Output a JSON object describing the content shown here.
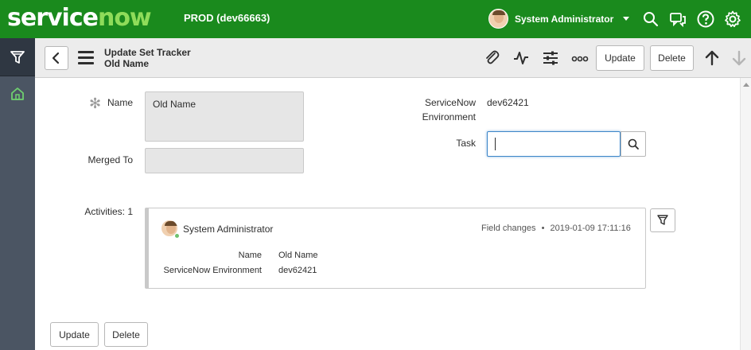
{
  "header": {
    "logo_part1": "service",
    "logo_part2": "now",
    "instance": "PROD (dev66663)",
    "user": "System Administrator"
  },
  "form_header": {
    "title": "Update Set Tracker",
    "subtitle": "Old Name",
    "update_label": "Update",
    "delete_label": "Delete"
  },
  "fields": {
    "name_label": "Name",
    "name_value": "Old Name",
    "merged_to_label": "Merged To",
    "merged_to_value": "",
    "sn_env_label_1": "ServiceNow",
    "sn_env_label_2": "Environment",
    "sn_env_value": "dev62421",
    "task_label": "Task",
    "task_value": ""
  },
  "activities": {
    "label": "Activities: 1",
    "entry": {
      "user": "System Administrator",
      "type": "Field changes",
      "separator": "•",
      "timestamp": "2019-01-09 17:11:16",
      "changes": [
        {
          "field": "Name",
          "value": "Old Name"
        },
        {
          "field": "ServiceNow Environment",
          "value": "dev62421"
        }
      ]
    }
  },
  "footer": {
    "update_label": "Update",
    "delete_label": "Delete"
  },
  "colors": {
    "header_bg": "#1a8a1d",
    "logo_accent": "#8fdc5a",
    "nav_bg": "#4b5563",
    "focus_border": "#3d86c9"
  }
}
